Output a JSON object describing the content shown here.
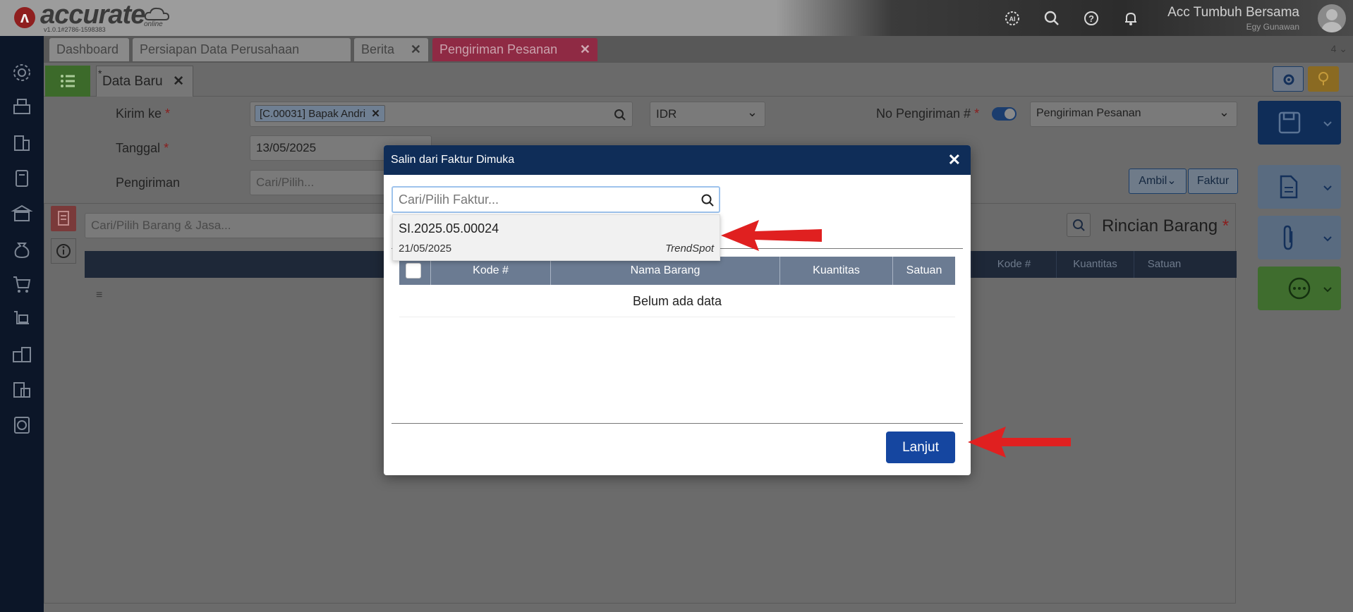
{
  "header": {
    "logo_text": "accurate",
    "logo_sub": "online",
    "version": "v1.0.1#2786-1598383",
    "company": "Acc Tumbuh Bersama",
    "user": "Egy Gunawan"
  },
  "tabs": [
    {
      "label": "Dashboard"
    },
    {
      "label": "Persiapan Data Perusahaan"
    },
    {
      "label": "Berita"
    },
    {
      "label": "Pengiriman Pesanan"
    }
  ],
  "tabs_count": "4",
  "doc": {
    "star": "*",
    "tab_label": "Data Baru"
  },
  "form": {
    "kirim_ke_label": "Kirim ke",
    "kirim_ke_value": "[C.00031] Bapak Andri",
    "currency": "IDR",
    "no_pengiriman_label": "No Pengiriman #",
    "type_select": "Pengiriman Pesanan",
    "tanggal_label": "Tanggal",
    "tanggal_value": "13/05/2025",
    "pengiriman_label": "Pengiriman",
    "pengiriman_placeholder": "Cari/Pilih...",
    "required_mark": "*",
    "ambil_label": "Ambil",
    "faktur_label": "Faktur",
    "barang_placeholder": "Cari/Pilih Barang & Jasa...",
    "rincian_label": "Rincian Barang"
  },
  "bg_grid": {
    "columns": [
      "Kode #",
      "Kuantitas",
      "Satuan"
    ]
  },
  "modal": {
    "title": "Salin dari Faktur Dimuka",
    "search_placeholder": "Cari/Pilih Faktur...",
    "dropdown_item": {
      "number": "SI.2025.05.00024",
      "date": "21/05/2025",
      "customer": "TrendSpot"
    },
    "columns": [
      "Kode #",
      "Nama Barang",
      "Kuantitas",
      "Satuan"
    ],
    "empty_text": "Belum ada data",
    "next_button": "Lanjut"
  },
  "colors": {
    "modal_header": "#0f2d58",
    "primary_button": "#1546a0",
    "active_tab": "#8f2a44",
    "arrow": "#e02020"
  }
}
